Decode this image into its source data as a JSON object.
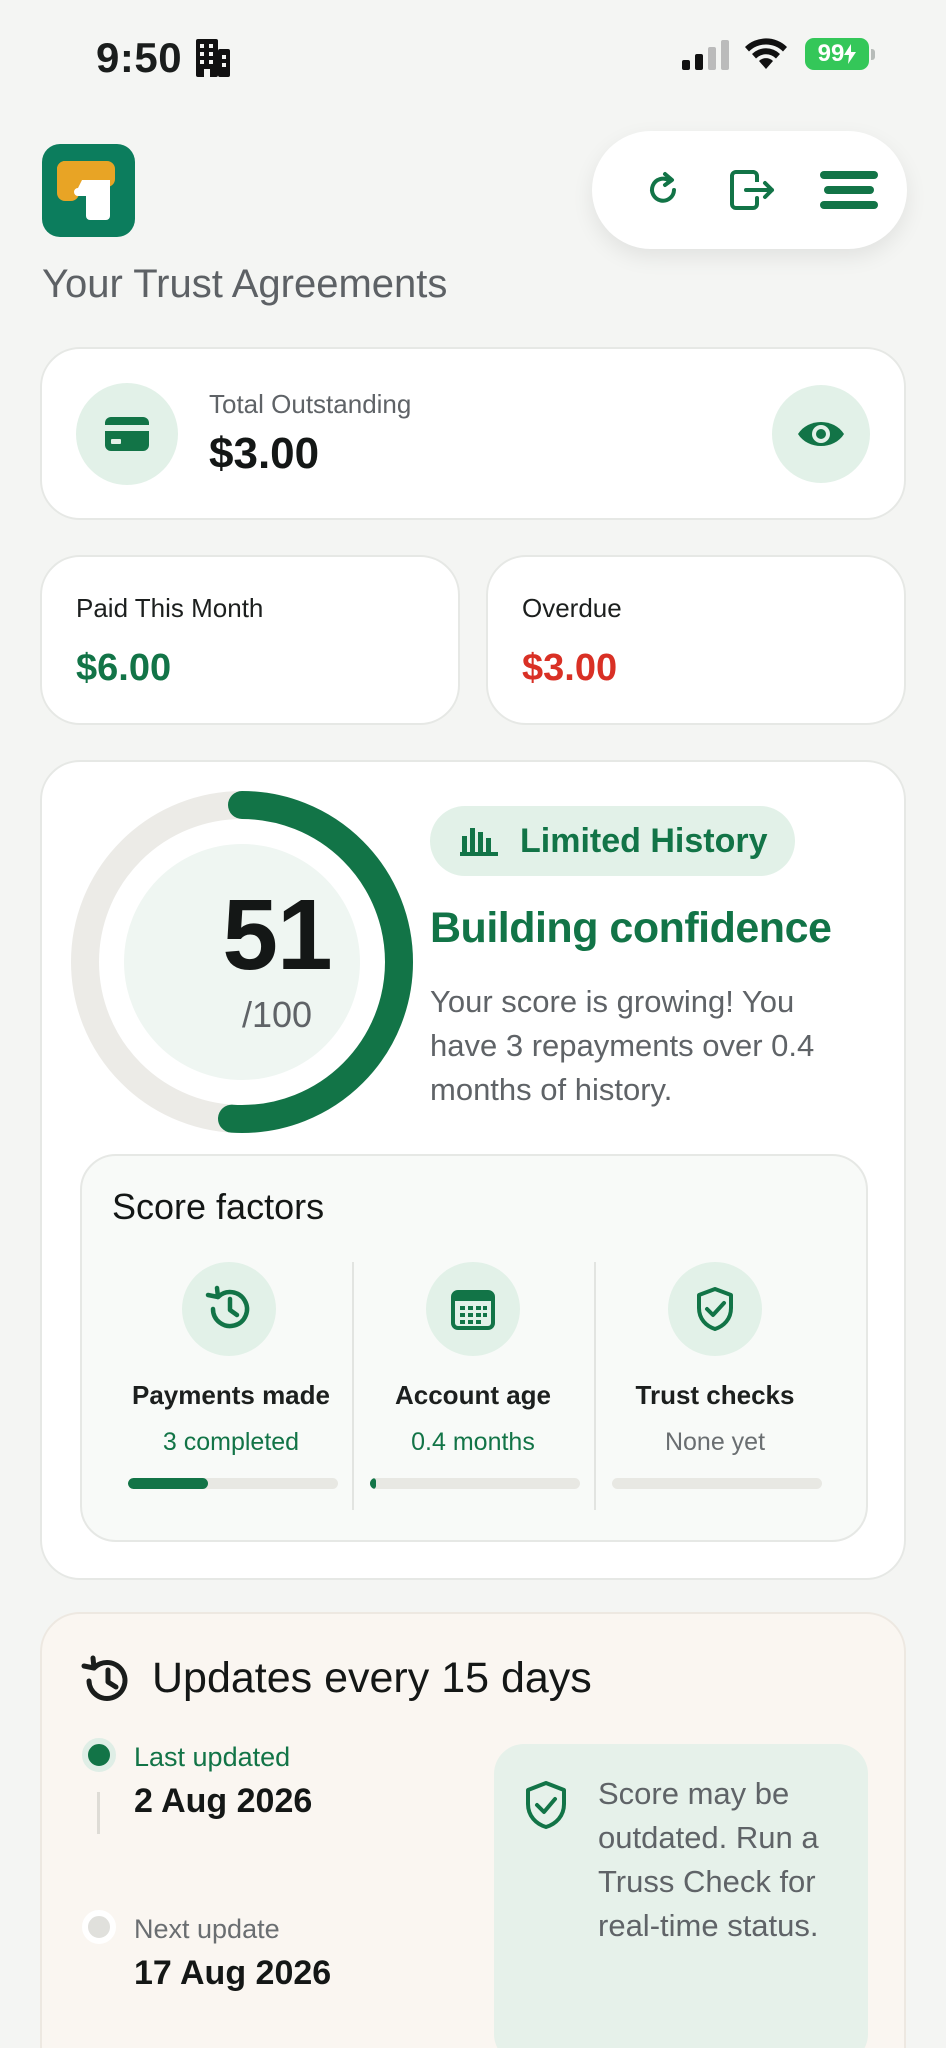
{
  "status_bar": {
    "time": "9:50",
    "battery": "99"
  },
  "header": {
    "title": "Your Trust Agreements",
    "refresh_icon": "refresh-icon",
    "logout_icon": "logout-icon",
    "menu_icon": "menu-icon"
  },
  "outstanding": {
    "label": "Total Outstanding",
    "value": "$3.00"
  },
  "stats": {
    "paid": {
      "label": "Paid This Month",
      "value": "$6.00"
    },
    "overdue": {
      "label": "Overdue",
      "value": "$3.00"
    }
  },
  "score": {
    "value": "51",
    "max": "/100",
    "progress": 0.51,
    "badge": "Limited History",
    "headline": "Building confidence",
    "description": "Your score is growing! You have 3 repayments over 0.4 months of history."
  },
  "factors": {
    "title": "Score factors",
    "items": [
      {
        "title": "Payments made",
        "subtitle": "3 completed",
        "progress": 0.38,
        "icon": "history-icon"
      },
      {
        "title": "Account age",
        "subtitle": "0.4 months",
        "progress": 0.03,
        "icon": "calendar-icon"
      },
      {
        "title": "Trust checks",
        "subtitle": "None yet",
        "progress": 0,
        "icon": "shield-check-icon"
      }
    ]
  },
  "updates": {
    "title": "Updates every 15 days",
    "last_label": "Last updated",
    "last_value": "2 Aug 2026",
    "next_label": "Next update",
    "next_value": "17 Aug 2026",
    "notice": "Score may be outdated. Run a Truss Check for real-time status."
  },
  "colors": {
    "brand": "#127447",
    "danger": "#d93025",
    "accent_light": "#e2f1e8"
  }
}
